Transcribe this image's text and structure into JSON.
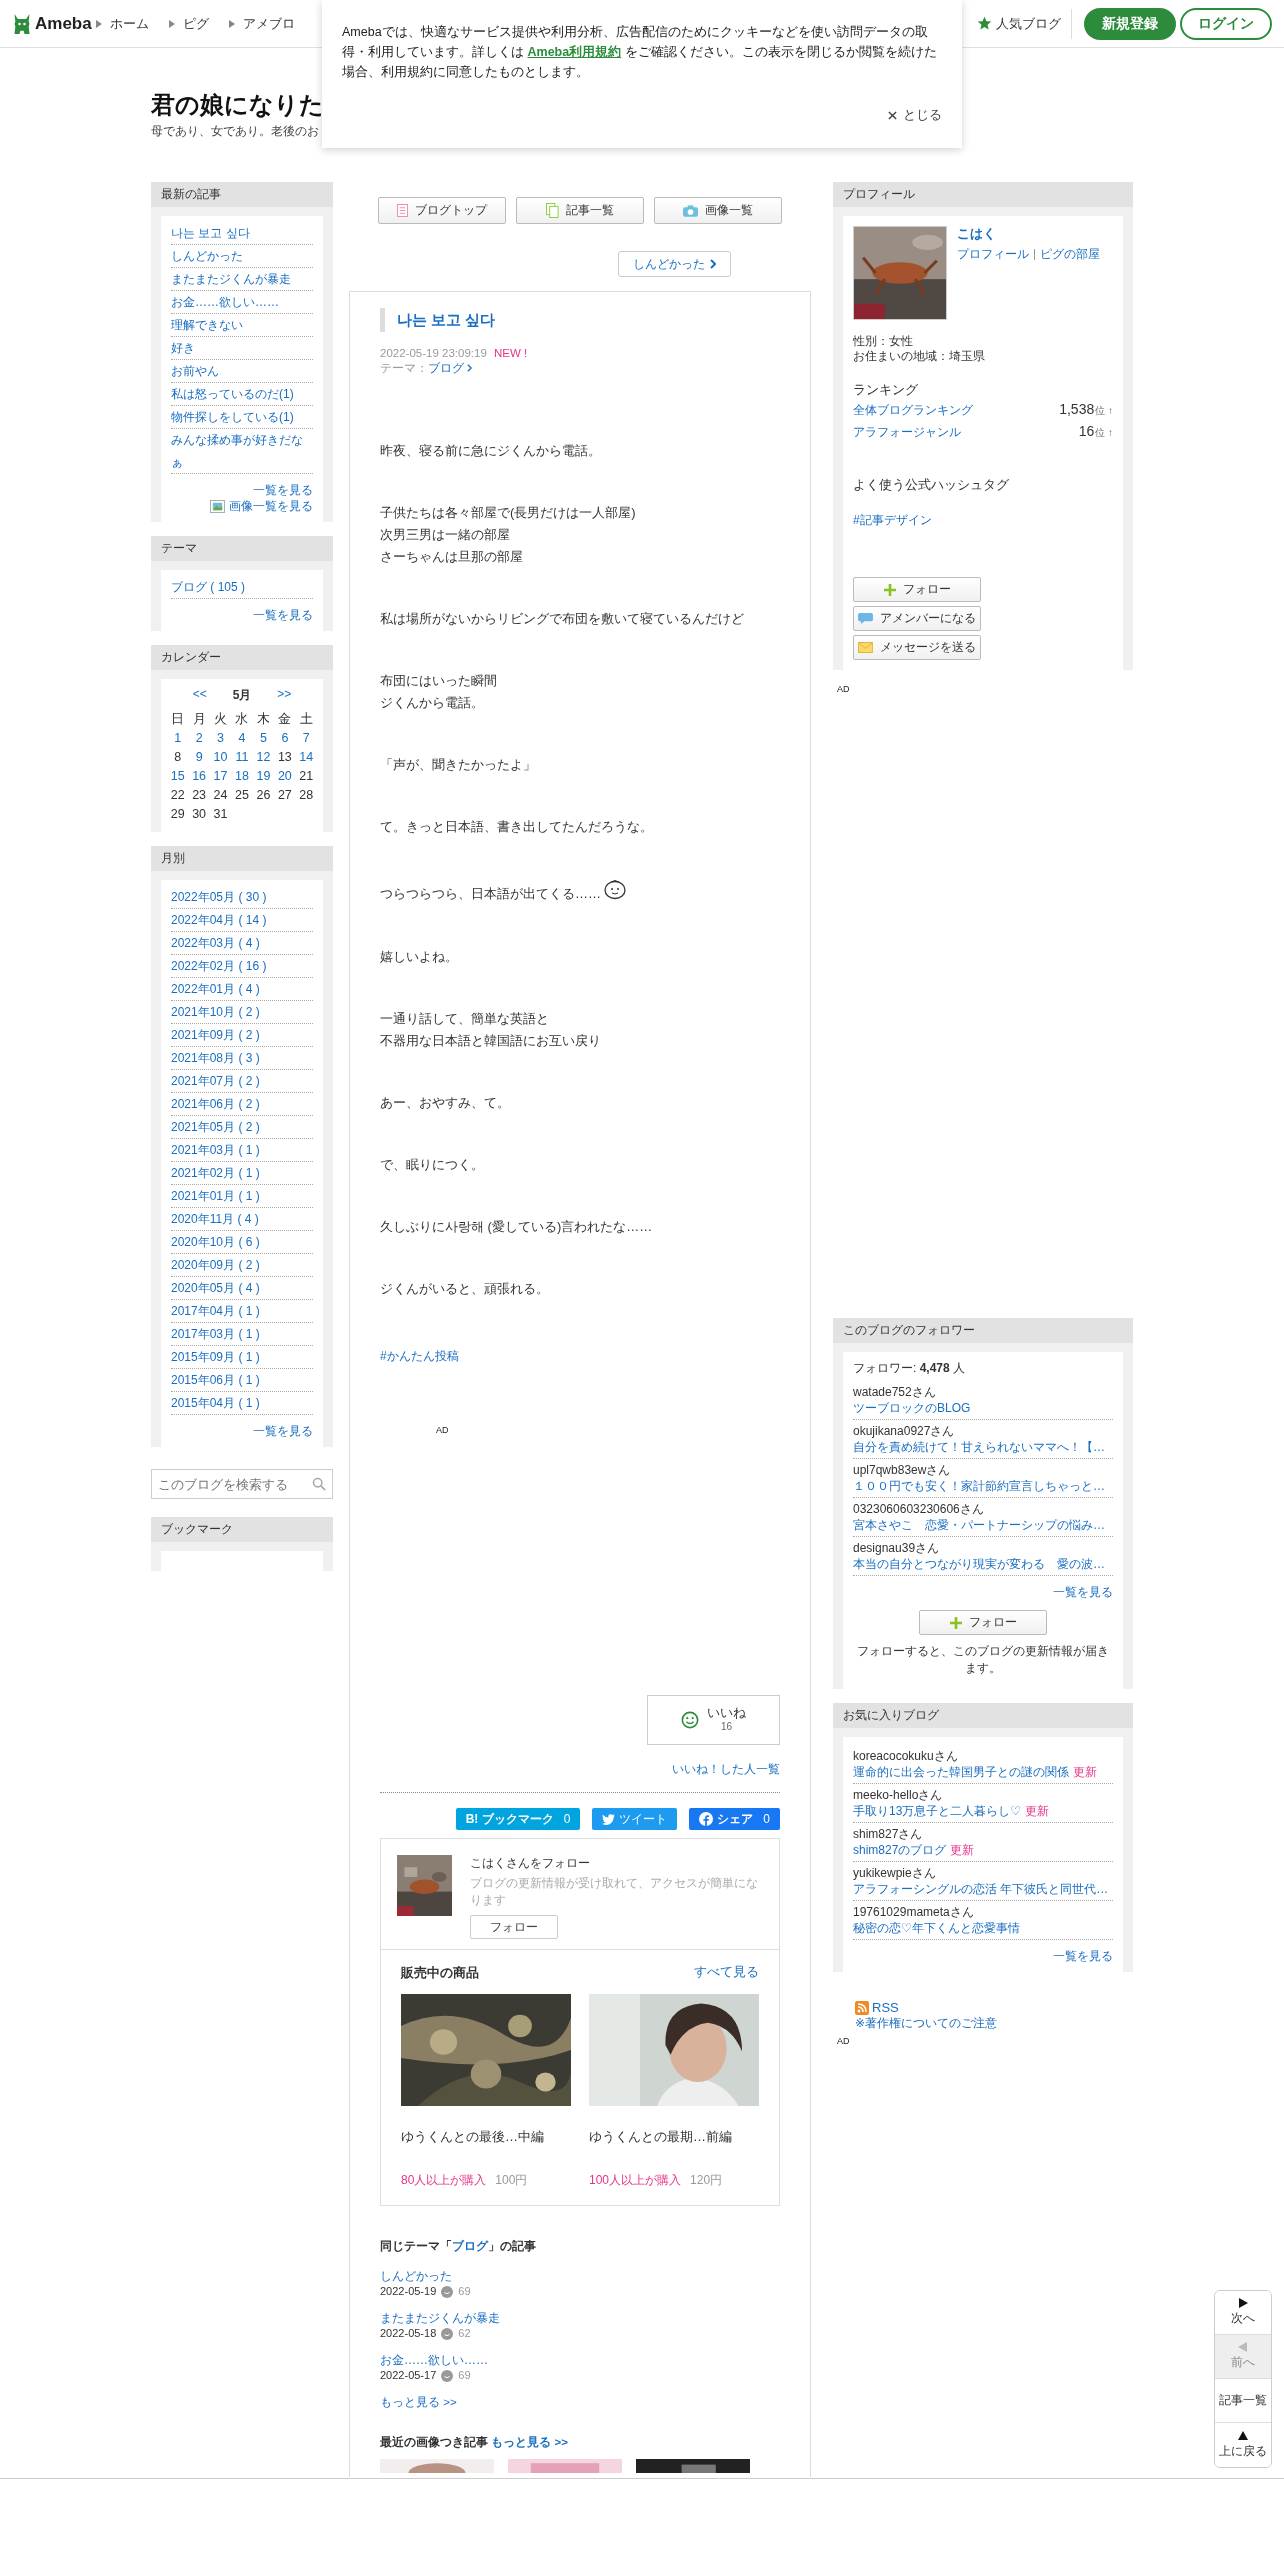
{
  "header": {
    "logo": "Ameba",
    "nav": [
      "ホーム",
      "ピグ",
      "アメブロ"
    ],
    "popular": "人気ブログ",
    "signup": "新規登録",
    "login": "ログイン"
  },
  "cookie_notice": {
    "text_before": "Amebaでは、快適なサービス提供や利用分析、広告配信のためにクッキーなどを使い訪問データの取得・利用しています。詳しくは ",
    "link": "Ameba利用規約",
    "text_after": " をご確認ください。この表示を閉じるか閲覧を続けた場合、利用規約に同意したものとします。",
    "close": "とじる"
  },
  "blog": {
    "title": "君の娘になりた",
    "subtitle": "母であり、女であり。老後のお"
  },
  "latest": {
    "heading": "最新の記事",
    "items": [
      "나는 보고 싶다",
      "しんどかった",
      "またまたジくんが暴走",
      "お金……欲しい……",
      "理解できない",
      "好き",
      "お前やん",
      "私は怒っているのだ(1)",
      "物件探しをしている(1)",
      "みんな揉め事が好きだなぁ"
    ],
    "more": "一覧を見る",
    "images": "画像一覧を見る"
  },
  "themes": {
    "heading": "テーマ",
    "items": [
      "ブログ ( 105 )"
    ],
    "more": "一覧を見る"
  },
  "calendar": {
    "heading": "カレンダー",
    "prev": "<<",
    "month": "5月",
    "next": ">>",
    "weekdays": [
      "日",
      "月",
      "火",
      "水",
      "木",
      "金",
      "土"
    ],
    "days": [
      {
        "d": "1",
        "linked": true
      },
      {
        "d": "2",
        "linked": true
      },
      {
        "d": "3",
        "linked": true
      },
      {
        "d": "4",
        "linked": true
      },
      {
        "d": "5",
        "linked": true
      },
      {
        "d": "6",
        "linked": true
      },
      {
        "d": "7",
        "linked": true
      },
      {
        "d": "8",
        "linked": false
      },
      {
        "d": "9",
        "linked": true
      },
      {
        "d": "10",
        "linked": true
      },
      {
        "d": "11",
        "linked": true
      },
      {
        "d": "12",
        "linked": true
      },
      {
        "d": "13",
        "linked": false
      },
      {
        "d": "14",
        "linked": true
      },
      {
        "d": "15",
        "linked": true
      },
      {
        "d": "16",
        "linked": true
      },
      {
        "d": "17",
        "linked": true
      },
      {
        "d": "18",
        "linked": true
      },
      {
        "d": "19",
        "linked": true
      },
      {
        "d": "20",
        "linked": true
      },
      {
        "d": "21",
        "linked": false
      },
      {
        "d": "22",
        "linked": false
      },
      {
        "d": "23",
        "linked": false
      },
      {
        "d": "24",
        "linked": false
      },
      {
        "d": "25",
        "linked": false
      },
      {
        "d": "26",
        "linked": false
      },
      {
        "d": "27",
        "linked": false
      },
      {
        "d": "28",
        "linked": false
      },
      {
        "d": "29",
        "linked": false
      },
      {
        "d": "30",
        "linked": false
      },
      {
        "d": "31",
        "linked": false
      }
    ]
  },
  "archive": {
    "heading": "月別",
    "items": [
      "2022年05月 ( 30 )",
      "2022年04月 ( 14 )",
      "2022年03月 ( 4 )",
      "2022年02月 ( 16 )",
      "2022年01月 ( 4 )",
      "2021年10月 ( 2 )",
      "2021年09月 ( 2 )",
      "2021年08月 ( 3 )",
      "2021年07月 ( 2 )",
      "2021年06月 ( 2 )",
      "2021年05月 ( 2 )",
      "2021年03月 ( 1 )",
      "2021年02月 ( 1 )",
      "2021年01月 ( 1 )",
      "2020年11月 ( 4 )",
      "2020年10月 ( 6 )",
      "2020年09月 ( 2 )",
      "2020年05月 ( 4 )",
      "2017年04月 ( 1 )",
      "2017年03月 ( 1 )",
      "2015年09月 ( 1 )",
      "2015年06月 ( 1 )",
      "2015年04月 ( 1 )"
    ],
    "more": "一覧を見る"
  },
  "search": {
    "placeholder": "このブログを検索する"
  },
  "bookmarks": {
    "heading": "ブックマーク"
  },
  "toolbar": [
    "ブログトップ",
    "記事一覧",
    "画像一覧"
  ],
  "next_article": "しんどかった",
  "article": {
    "title": "나는 보고 싶다",
    "date": "2022-05-19 23:09:19",
    "new": "NEW !",
    "theme_label": "テーマ：",
    "theme": "ブログ",
    "paragraphs": [
      [
        "昨夜、寝る前に急にジくんから電話。"
      ],
      [
        "子供たちは各々部屋で(長男だけは一人部屋)",
        "次男三男は一緒の部屋",
        "さーちゃんは旦那の部屋"
      ],
      [
        "私は場所がないからリビングで布団を敷いて寝ているんだけど"
      ],
      [
        "布団にはいった瞬間",
        "ジくんから電話。"
      ],
      [
        "「声が、聞きたかったよ」"
      ],
      [
        "て。きっと日本語、書き出してたんだろうな。"
      ],
      [
        "つらつらつら、日本語が出てくる……"
      ],
      [
        "嬉しいよね。"
      ],
      [
        "一通り話して、簡単な英語と",
        "不器用な日本語と韓国語にお互い戻り"
      ],
      [
        "あー、おやすみ、て。"
      ],
      [
        "で、眠りにつく。"
      ],
      [
        "久しぶりに사랑해 (愛している)言われたな……"
      ],
      [
        "ジくんがいると、頑張れる。"
      ]
    ],
    "hashtag": "#かんたん投稿",
    "ad": "AD",
    "like": "いいね",
    "like_count": "16",
    "liked_list": "いいね！した人一覧"
  },
  "share": [
    {
      "kind": "hatena",
      "label": "B! ブックマーク",
      "count": "0"
    },
    {
      "kind": "twitter",
      "label": "ツイート"
    },
    {
      "kind": "facebook",
      "label": "シェア",
      "count": "0"
    }
  ],
  "follow_box": {
    "title": "こはくさんをフォロー",
    "desc": "ブログの更新情報が受け取れて、アクセスが簡単になります",
    "button": "フォロー"
  },
  "shop": {
    "heading": "販売中の商品",
    "all": "すべて見る",
    "items": [
      {
        "title": "ゆうくんとの最後…中編",
        "buyers": "80人以上が購入",
        "price": "100円"
      },
      {
        "title": "ゆうくんとの最期…前編",
        "buyers": "100人以上が購入",
        "price": "120円"
      }
    ]
  },
  "same_theme": {
    "before": "同じテーマ「",
    "theme": "ブログ",
    "after": "」の記事",
    "items": [
      {
        "title": "しんどかった",
        "date": "2022-05-19",
        "count": "69"
      },
      {
        "title": "またまたジくんが暴走",
        "date": "2022-05-18",
        "count": "62"
      },
      {
        "title": "お金……欲しい……",
        "date": "2022-05-17",
        "count": "69"
      }
    ],
    "more": "もっと見る >>"
  },
  "recent_images": {
    "heading": "最近の画像つき記事",
    "more": "もっと見る >>"
  },
  "profile": {
    "heading": "プロフィール",
    "name": "こはく",
    "links": [
      "プロフィール",
      "ピグの部屋"
    ],
    "info": [
      "性別：女性",
      "お住まいの地域：埼玉県"
    ],
    "ranking_heading": "ランキング",
    "rankings": [
      {
        "name": "全体ブログランキング",
        "rank": "1,538",
        "unit": "位",
        "trend": "↑"
      },
      {
        "name": "アラフォージャンル",
        "rank": "16",
        "unit": "位",
        "trend": "↑"
      }
    ],
    "hashtag_heading": "よく使う公式ハッシュタグ",
    "hashtag": "#記事デザイン",
    "follow": "フォロー",
    "amember": "アメンバーになる",
    "message": "メッセージを送る"
  },
  "right_ads": [
    "AD",
    "AD"
  ],
  "followers": {
    "heading": "このブログのフォロワー",
    "label": "フォロワー: ",
    "count": "4,478",
    "unit": " 人",
    "items": [
      {
        "name": "watade752さん",
        "blog": "ツーブロックのBLOG"
      },
      {
        "name": "okujikana0927さん",
        "blog": "自分を責め続けて！甘えられないママへ！【…"
      },
      {
        "name": "upl7qwb83ewさん",
        "blog": "１００円でも安く！家計節約宣言しちゃっと…"
      },
      {
        "name": "0323060603230606さん",
        "blog": "宮本さやこ　恋愛・パートナーシップの悩み…"
      },
      {
        "name": "designau39さん",
        "blog": "本当の自分とつながり現実が変わる　愛の波…"
      }
    ],
    "more": "一覧を見る",
    "follow": "フォロー",
    "note": "フォローすると、このブログの更新情報が届きます。"
  },
  "favorites": {
    "heading": "お気に入りブログ",
    "items": [
      {
        "name": "koreacocokukuさん",
        "blog": "運命的に出会った韓国男子との謎の関係",
        "badge": "更新"
      },
      {
        "name": "meeko-helloさん",
        "blog": "手取り13万息子と二人暮らし♡",
        "badge": "更新"
      },
      {
        "name": "shim827さん",
        "blog": "shim827のブログ",
        "badge": "更新"
      },
      {
        "name": "yukikewpieさん",
        "blog": "アラフォーシングルの恋活 年下彼氏と同世代…"
      },
      {
        "name": "19761029mametaさん",
        "blog": "秘密の恋♡年下くんと恋愛事情"
      }
    ],
    "more": "一覧を見る"
  },
  "rss": {
    "label": "RSS",
    "note": "※著作権についてのご注意"
  },
  "page_nav": [
    {
      "kind": "next",
      "label": "次へ",
      "disabled": false
    },
    {
      "kind": "prev",
      "label": "前へ",
      "disabled": true
    },
    {
      "kind": "list",
      "label": "記事一覧",
      "disabled": false
    },
    {
      "kind": "top",
      "label": "上に戻る",
      "disabled": false
    }
  ]
}
